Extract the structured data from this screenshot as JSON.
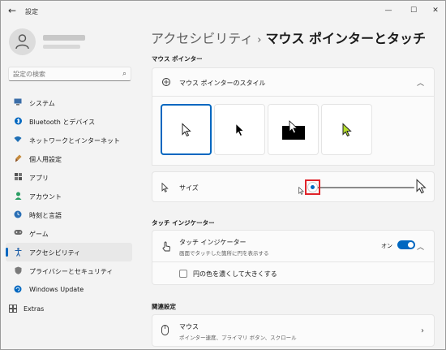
{
  "window": {
    "title": "設定"
  },
  "user": {
    "name": "",
    "email": ""
  },
  "search": {
    "placeholder": "設定の検索"
  },
  "nav": {
    "items": [
      {
        "label": "システム",
        "icon": "monitor-icon",
        "color": "#3b6ea8"
      },
      {
        "label": "Bluetooth とデバイス",
        "icon": "bluetooth-icon",
        "color": "#0067c0"
      },
      {
        "label": "ネットワークとインターネット",
        "icon": "wifi-icon",
        "color": "#1f6fb5"
      },
      {
        "label": "個人用設定",
        "icon": "brush-icon",
        "color": "#b5651d"
      },
      {
        "label": "アプリ",
        "icon": "apps-icon",
        "color": "#555555"
      },
      {
        "label": "アカウント",
        "icon": "account-icon",
        "color": "#2a9d63"
      },
      {
        "label": "時刻と言語",
        "icon": "globe-clock-icon",
        "color": "#2a6fb5"
      },
      {
        "label": "ゲーム",
        "icon": "gamepad-icon",
        "color": "#6a6a6a"
      },
      {
        "label": "アクセシビリティ",
        "icon": "accessibility-icon",
        "color": "#1f5fa8",
        "active": true
      },
      {
        "label": "プライバシーとセキュリティ",
        "icon": "shield-icon",
        "color": "#6a6a6a"
      },
      {
        "label": "Windows Update",
        "icon": "update-icon",
        "color": "#0067c0"
      }
    ],
    "extras": {
      "label": "Extras",
      "icon": "extras-icon"
    }
  },
  "breadcrumb": {
    "parent": "アクセシビリティ",
    "separator": "›",
    "current": "マウス ポインターとタッチ"
  },
  "mouse_pointer": {
    "section_title": "マウス ポインター",
    "style_label": "マウス ポインターのスタイル",
    "style_options": [
      {
        "name": "white",
        "selected": true
      },
      {
        "name": "black",
        "selected": false
      },
      {
        "name": "inverted",
        "selected": false
      },
      {
        "name": "custom",
        "selected": false,
        "color": "#b6e02c"
      }
    ],
    "size_label": "サイズ",
    "size_value_fraction": 0.0
  },
  "touch": {
    "section_title": "タッチ インジケーター",
    "label": "タッチ インジケーター",
    "description": "画面でタッチした箇所に円を表示する",
    "toggle_label": "オン",
    "toggle_on": true,
    "option_label": "円の色を濃くして大きくする",
    "option_checked": false
  },
  "related": {
    "section_title": "関連設定",
    "mouse_label": "マウス",
    "mouse_desc": "ポインター速度、プライマリ ボタン、スクロール"
  },
  "colors": {
    "accent": "#0067c0",
    "highlight": "#e0242a"
  }
}
